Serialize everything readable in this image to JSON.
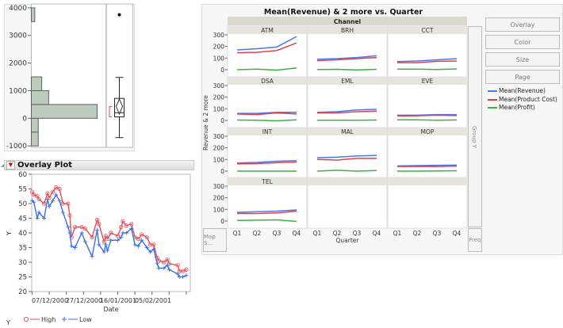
{
  "distribution": {
    "chart_data": {
      "type": "histogram",
      "ylim": [
        -1000,
        4000
      ],
      "yticks": [
        "4000",
        "3000",
        "2000",
        "1000",
        "0",
        "-1000"
      ],
      "bins": [
        {
          "from": -1000,
          "to": -500,
          "count": 2
        },
        {
          "from": -500,
          "to": 0,
          "count": 2
        },
        {
          "from": 0,
          "to": 500,
          "count": 19
        },
        {
          "from": 500,
          "to": 1000,
          "count": 5
        },
        {
          "from": 1000,
          "to": 1500,
          "count": 3
        },
        {
          "from": 3500,
          "to": 4000,
          "count": 1
        }
      ],
      "boxplot": {
        "whisker_low": -700,
        "q1": 50,
        "median": 200,
        "q3": 720,
        "whisker_high": 1480,
        "mean": 430,
        "mean_ci": [
          150,
          700
        ],
        "shortest_half": [
          50,
          420
        ],
        "outliers": [
          3750
        ]
      },
      "bar_color": "#bccbbc"
    }
  },
  "overlay": {
    "title": "Overlay Plot",
    "chart_data": {
      "type": "line",
      "xlabel": "Date",
      "ylabel": "Y",
      "ylim": [
        20,
        60
      ],
      "yticks": [
        "60",
        "55",
        "50",
        "45",
        "40",
        "35",
        "30",
        "25",
        "20"
      ],
      "xrange": [
        "2000-11-27",
        "2001-02-26"
      ],
      "xtick_labels": [
        "07/12/2000",
        "27/12/2000",
        "16/01/2001",
        "05/02/2001"
      ],
      "legend_title": "Y",
      "series": [
        {
          "name": "High",
          "color": "#e0505a",
          "marker": "circle"
        },
        {
          "name": "Low",
          "color": "#3c6fe0",
          "marker": "plus"
        }
      ],
      "points": [
        [
          "2000-11-27",
          54,
          51
        ],
        [
          "2000-11-28",
          53,
          50.5
        ],
        [
          "2000-11-30",
          52.5,
          45
        ],
        [
          "2000-12-01",
          51.5,
          47
        ],
        [
          "2000-12-04",
          50,
          45
        ],
        [
          "2000-12-06",
          53.5,
          51.5
        ],
        [
          "2000-12-07",
          52,
          49
        ],
        [
          "2000-12-09",
          54,
          51
        ],
        [
          "2000-12-11",
          55.5,
          53
        ],
        [
          "2000-12-13",
          55,
          51
        ],
        [
          "2000-12-15",
          50,
          47
        ],
        [
          "2000-12-18",
          50,
          42
        ],
        [
          "2000-12-19",
          46,
          40
        ],
        [
          "2000-12-20",
          38.5,
          35.5
        ],
        [
          "2000-12-22",
          42,
          35
        ],
        [
          "2000-12-26",
          42,
          40
        ],
        [
          "2000-12-28",
          41.5,
          37
        ],
        [
          "2001-01-01",
          38.5,
          32
        ],
        [
          "2001-01-04",
          44.5,
          41
        ],
        [
          "2001-01-05",
          43,
          36
        ],
        [
          "2001-01-08",
          37,
          33.5
        ],
        [
          "2001-01-09",
          39,
          36
        ],
        [
          "2001-01-10",
          38,
          34
        ],
        [
          "2001-01-12",
          40,
          37.5
        ],
        [
          "2001-01-16",
          39,
          37.5
        ],
        [
          "2001-01-18",
          42,
          38.5
        ],
        [
          "2001-01-19",
          44,
          40
        ],
        [
          "2001-01-21",
          42.5,
          40
        ],
        [
          "2001-01-24",
          43,
          41.5
        ],
        [
          "2001-01-26",
          38.5,
          36
        ],
        [
          "2001-01-28",
          38,
          35.5
        ],
        [
          "2001-01-30",
          39.5,
          37.5
        ],
        [
          "2001-02-02",
          38.5,
          35
        ],
        [
          "2001-02-04",
          36,
          33.5
        ],
        [
          "2001-02-06",
          36,
          34.5
        ],
        [
          "2001-02-08",
          31.5,
          29.5
        ],
        [
          "2001-02-09",
          30.5,
          28
        ],
        [
          "2001-02-12",
          30,
          28
        ],
        [
          "2001-02-14",
          31,
          29
        ],
        [
          "2001-02-15",
          29.5,
          27.5
        ],
        [
          "2001-02-20",
          29,
          26
        ],
        [
          "2001-02-21",
          27,
          25
        ],
        [
          "2001-02-23",
          27,
          25
        ],
        [
          "2001-02-25",
          27.5,
          25.5
        ]
      ]
    }
  },
  "graph_builder": {
    "chart_data": {
      "type": "line",
      "title": "Mean(Revenue) & 2 more vs. Quarter",
      "group_x_title": "Channel",
      "xlabel": "Quarter",
      "ylabel": "Revenue & 2 more",
      "categories": [
        "Q1",
        "Q2",
        "Q3",
        "Q4"
      ],
      "ylim": [
        -20,
        320
      ],
      "yticks": [
        "300",
        "200",
        "100",
        "0"
      ],
      "series": [
        {
          "name": "Mean(Revenue)",
          "color": "#4a78e6"
        },
        {
          "name": "Mean(Product Cost)",
          "color": "#e0404e"
        },
        {
          "name": "Mean(Profit)",
          "color": "#3cb043"
        }
      ],
      "panels": [
        {
          "label": "ATM",
          "values": [
            [
              170,
              180,
              195,
              285
            ],
            [
              145,
              150,
              165,
              230
            ],
            [
              0,
              5,
              -3,
              15
            ]
          ]
        },
        {
          "label": "BRH",
          "values": [
            [
              90,
              95,
              105,
              120
            ],
            [
              78,
              85,
              95,
              105
            ],
            [
              2,
              3,
              -2,
              3
            ]
          ]
        },
        {
          "label": "CCT",
          "values": [
            [
              70,
              75,
              85,
              95
            ],
            [
              60,
              60,
              72,
              75
            ],
            [
              5,
              5,
              2,
              7
            ]
          ]
        },
        {
          "label": "DSA",
          "values": [
            [
              60,
              60,
              70,
              70
            ],
            [
              55,
              50,
              65,
              55
            ],
            [
              3,
              2,
              -3,
              5
            ]
          ]
        },
        {
          "label": "EML",
          "values": [
            [
              70,
              75,
              90,
              95
            ],
            [
              65,
              65,
              75,
              80
            ],
            [
              2,
              2,
              2,
              3
            ]
          ]
        },
        {
          "label": "EVE",
          "values": [
            [
              45,
              45,
              50,
              50
            ],
            [
              38,
              40,
              45,
              42
            ],
            [
              5,
              5,
              2,
              4
            ]
          ]
        },
        {
          "label": "INT",
          "values": [
            [
              70,
              75,
              85,
              90
            ],
            [
              62,
              65,
              72,
              78
            ],
            [
              0,
              0,
              0,
              0
            ]
          ]
        },
        {
          "label": "MAL",
          "values": [
            [
              115,
              120,
              130,
              135
            ],
            [
              100,
              95,
              110,
              110
            ],
            [
              0,
              8,
              0,
              5
            ]
          ]
        },
        {
          "label": "MOP",
          "values": [
            [
              45,
              48,
              50,
              52
            ],
            [
              40,
              40,
              40,
              43
            ],
            [
              0,
              0,
              2,
              3
            ]
          ]
        },
        {
          "label": "TEL",
          "values": [
            [
              75,
              80,
              85,
              95
            ],
            [
              65,
              65,
              70,
              85
            ],
            [
              5,
              8,
              10,
              -3
            ]
          ]
        }
      ]
    },
    "zones": {
      "group_y": "Group Y",
      "freq": "Freq",
      "map_shape": "Map S..."
    },
    "buttons": [
      "Overlay",
      "Color",
      "Size",
      "Page"
    ]
  }
}
